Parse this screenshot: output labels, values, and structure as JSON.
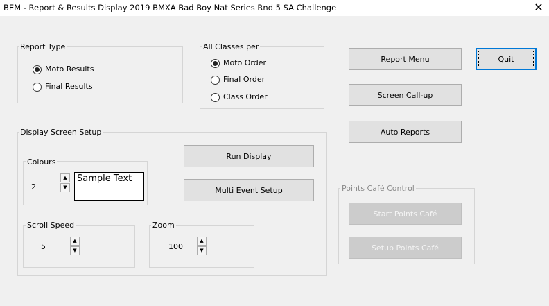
{
  "window": {
    "title": "BEM - Report & Results Display  2019 BMXA Bad Boy Nat Series Rnd 5 SA Challenge",
    "close_glyph": "✕"
  },
  "report_type": {
    "label": "Report Type",
    "options": [
      "Moto Results",
      "Final Results"
    ],
    "selected": "Moto Results"
  },
  "all_classes": {
    "label": "All Classes per",
    "options": [
      "Moto Order",
      "Final Order",
      "Class Order"
    ],
    "selected": "Moto Order"
  },
  "display_setup": {
    "label": "Display Screen Setup",
    "colours": {
      "label": "Colours",
      "value": "2",
      "sample": "Sample Text"
    },
    "scroll_speed": {
      "label": "Scroll Speed",
      "value": "5"
    },
    "zoom": {
      "label": "Zoom",
      "value": "100"
    },
    "run_display": "Run Display",
    "multi_event": "Multi Event Setup"
  },
  "buttons": {
    "report_menu": "Report Menu",
    "quit": "Quit",
    "screen_callup": "Screen Call-up",
    "auto_reports": "Auto Reports"
  },
  "points_cafe": {
    "label": "Points Café Control",
    "start": "Start Points Café",
    "setup": "Setup Points Café"
  },
  "spinner_glyphs": {
    "up": "▲",
    "down": "▼"
  }
}
